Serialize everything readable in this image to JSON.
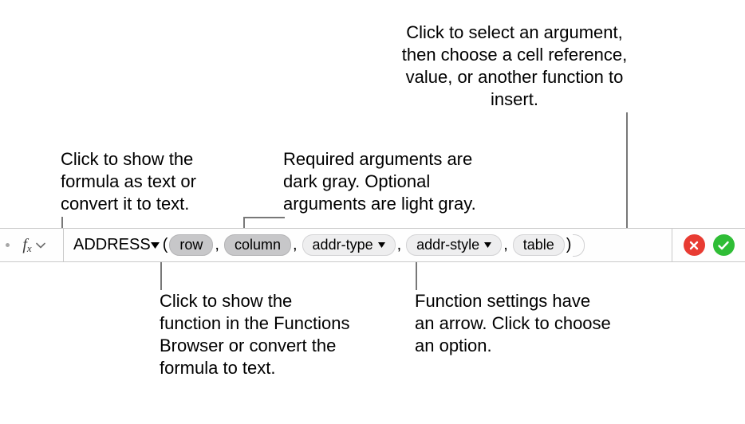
{
  "callouts": {
    "fx": "Click to show the formula as text or convert it to text.",
    "required": "Required arguments are dark gray. Optional arguments are light gray.",
    "argument": "Click to select an argument, then choose a cell reference, value, or another function to insert.",
    "fnname": "Click to show the function in the Functions Browser or convert the formula to text.",
    "settings": "Function settings have an arrow. Click to choose an option."
  },
  "bar": {
    "fx_f": "f",
    "fx_x": "x",
    "function_name": "ADDRESS",
    "open_paren": "(",
    "close_paren": ")",
    "comma": ",",
    "tokens": {
      "row": "row",
      "column": "column",
      "addr_type": "addr-type",
      "addr_style": "addr-style",
      "table": "table"
    }
  }
}
